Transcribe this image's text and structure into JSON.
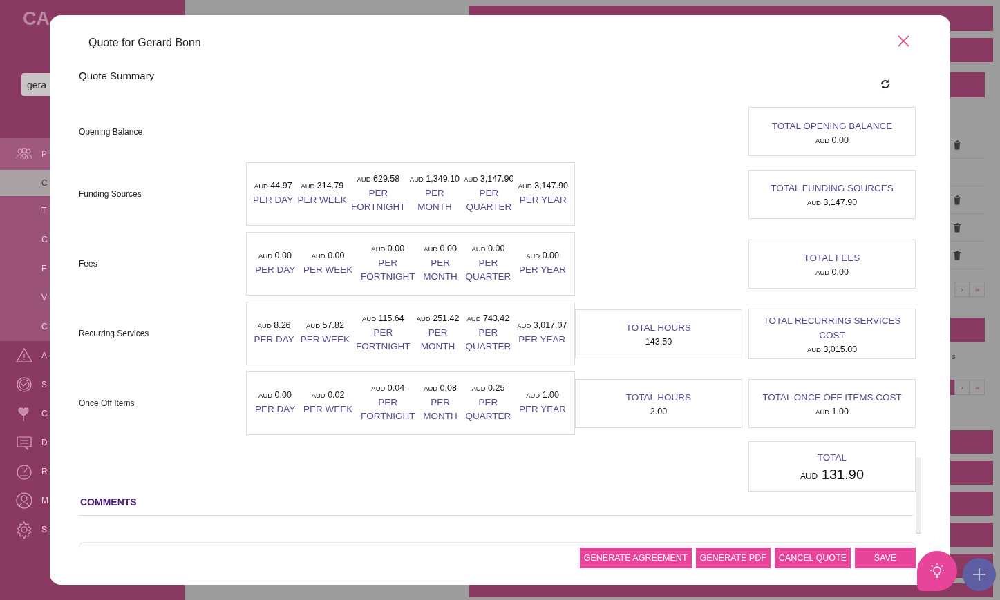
{
  "app": {
    "logo": "CA",
    "search": {
      "value": "gera"
    },
    "nav": [
      {
        "label": "P",
        "kind": "main",
        "selected": false
      },
      {
        "label": "C",
        "kind": "sub",
        "selected": true
      },
      {
        "label": "T",
        "kind": "sub",
        "selected": false
      },
      {
        "label": "C",
        "kind": "sub",
        "selected": false
      },
      {
        "label": "F",
        "kind": "sub",
        "selected": false
      },
      {
        "label": "V",
        "kind": "sub",
        "selected": false
      },
      {
        "label": "C",
        "kind": "sub",
        "selected": false
      },
      {
        "label": "A",
        "kind": "main",
        "selected": false
      },
      {
        "label": "S",
        "kind": "main",
        "selected": false
      },
      {
        "label": "C",
        "kind": "main",
        "selected": false
      },
      {
        "label": "D",
        "kind": "main",
        "selected": false
      },
      {
        "label": "R",
        "kind": "main",
        "selected": false
      },
      {
        "label": "M",
        "kind": "main",
        "selected": false
      },
      {
        "label": "S",
        "kind": "main",
        "selected": false
      }
    ],
    "pagers": [
      {
        "next": "›",
        "last": "»"
      },
      {
        "next": "›",
        "last": "»"
      }
    ],
    "fragment": "s"
  },
  "dialog": {
    "title": "Quote for Gerard Bonn",
    "heading": "Quote Summary",
    "rows": [
      {
        "label": "Opening Balance",
        "total": {
          "label": "TOTAL OPENING BALANCE",
          "currency": "AUD",
          "amount": "0.00"
        }
      },
      {
        "label": "Funding Sources",
        "periods": [
          {
            "currency": "AUD",
            "amount": "44.97",
            "period": "PER DAY"
          },
          {
            "currency": "AUD",
            "amount": "314.79",
            "period": "PER WEEK"
          },
          {
            "currency": "AUD",
            "amount": "629.58",
            "period": "PER FORTNIGHT"
          },
          {
            "currency": "AUD",
            "amount": "1,349.10",
            "period": "PER MONTH"
          },
          {
            "currency": "AUD",
            "amount": "3,147.90",
            "period": "PER QUARTER"
          },
          {
            "currency": "AUD",
            "amount": "3,147.90",
            "period": "PER YEAR"
          }
        ],
        "total": {
          "label": "TOTAL FUNDING SOURCES",
          "currency": "AUD",
          "amount": "3,147.90"
        }
      },
      {
        "label": "Fees",
        "periods": [
          {
            "currency": "AUD",
            "amount": "0.00",
            "period": "PER DAY"
          },
          {
            "currency": "AUD",
            "amount": "0.00",
            "period": "PER WEEK"
          },
          {
            "currency": "AUD",
            "amount": "0.00",
            "period": "PER FORTNIGHT"
          },
          {
            "currency": "AUD",
            "amount": "0.00",
            "period": "PER MONTH"
          },
          {
            "currency": "AUD",
            "amount": "0.00",
            "period": "PER QUARTER"
          },
          {
            "currency": "AUD",
            "amount": "0.00",
            "period": "PER YEAR"
          }
        ],
        "total": {
          "label": "TOTAL FEES",
          "currency": "AUD",
          "amount": "0.00"
        }
      },
      {
        "label": "Recurring Services",
        "periods": [
          {
            "currency": "AUD",
            "amount": "8.26",
            "period": "PER DAY"
          },
          {
            "currency": "AUD",
            "amount": "57.82",
            "period": "PER WEEK"
          },
          {
            "currency": "AUD",
            "amount": "115.64",
            "period": "PER FORTNIGHT"
          },
          {
            "currency": "AUD",
            "amount": "251.42",
            "period": "PER MONTH"
          },
          {
            "currency": "AUD",
            "amount": "743.42",
            "period": "PER QUARTER"
          },
          {
            "currency": "AUD",
            "amount": "3,017.07",
            "period": "PER YEAR"
          }
        ],
        "hours": {
          "label": "TOTAL HOURS",
          "value": "143.50"
        },
        "total": {
          "label": "TOTAL RECURRING SERVICES COST",
          "currency": "AUD",
          "amount": "3,015.00"
        }
      },
      {
        "label": "Once Off Items",
        "periods": [
          {
            "currency": "AUD",
            "amount": "0.00",
            "period": "PER DAY"
          },
          {
            "currency": "AUD",
            "amount": "0.02",
            "period": "PER WEEK"
          },
          {
            "currency": "AUD",
            "amount": "0.04",
            "period": "PER FORTNIGHT"
          },
          {
            "currency": "AUD",
            "amount": "0.08",
            "period": "PER MONTH"
          },
          {
            "currency": "AUD",
            "amount": "0.25",
            "period": "PER QUARTER"
          },
          {
            "currency": "AUD",
            "amount": "1.00",
            "period": "PER YEAR"
          }
        ],
        "hours": {
          "label": "TOTAL HOURS",
          "value": "2.00"
        },
        "total": {
          "label": "TOTAL ONCE OFF ITEMS COST",
          "currency": "AUD",
          "amount": "1.00"
        }
      }
    ],
    "grand_total": {
      "label": "TOTAL",
      "currency": "AUD",
      "amount": "131.90"
    },
    "comments_heading": "COMMENTS",
    "buttons": [
      "GENERATE AGREEMENT",
      "GENERATE PDF",
      "CANCEL QUOTE",
      "SAVE"
    ]
  }
}
